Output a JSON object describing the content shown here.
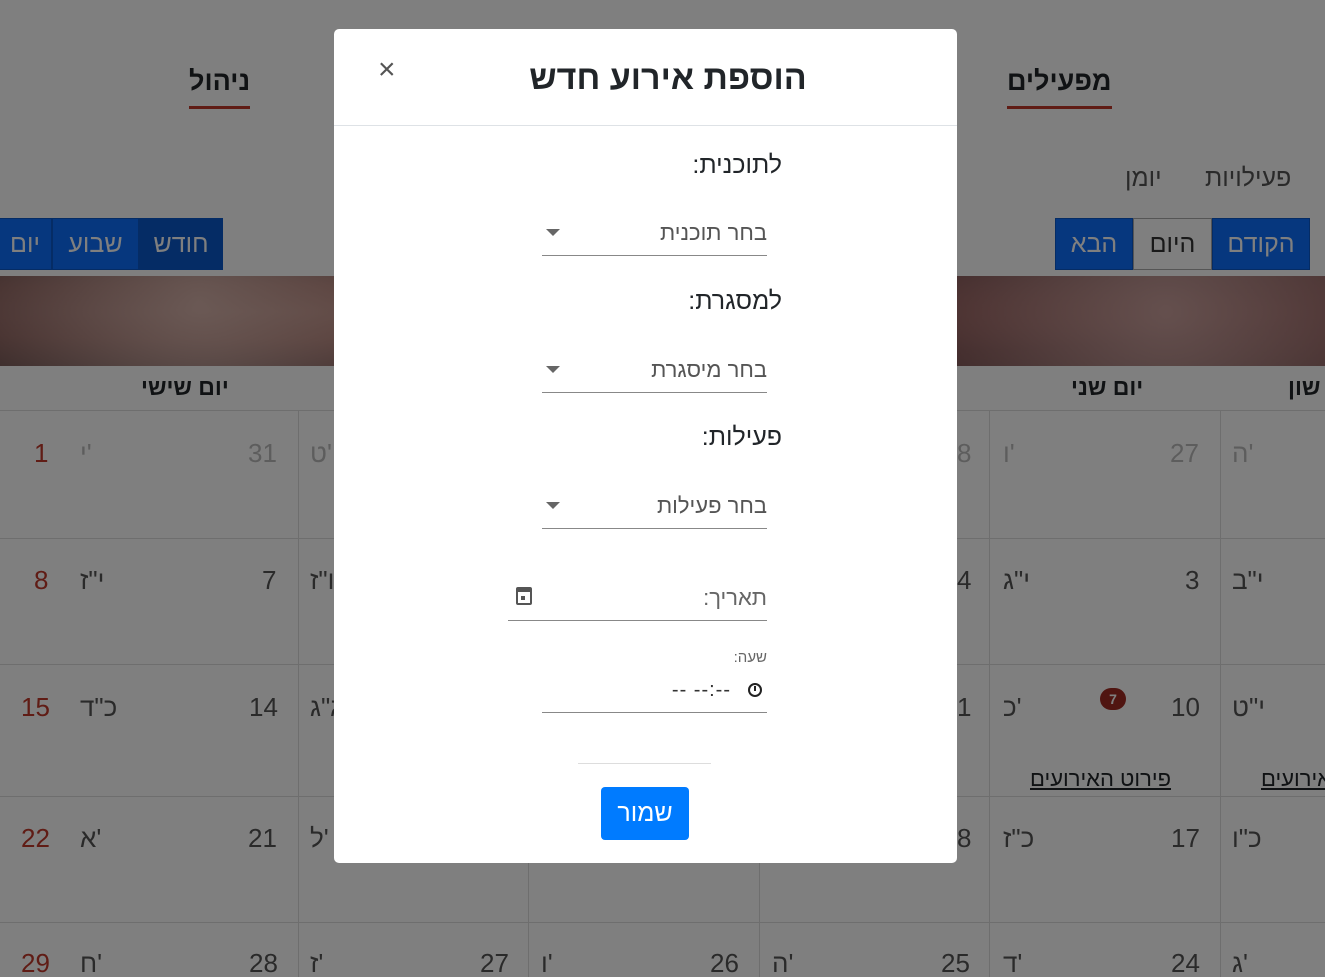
{
  "background": {
    "nav": {
      "manage": "ניהול",
      "operators": "מפעילים"
    },
    "sub_tabs": {
      "diary": "יומן",
      "activities": "פעילויות"
    },
    "view_buttons": {
      "day": "יום",
      "week": "שבוע",
      "month": "חודש"
    },
    "nav_buttons": {
      "next": "הבא",
      "today": "היום",
      "prev": "הקודם"
    },
    "day_headers": {
      "friday": "יום שישי",
      "monday": "יום שני",
      "sunday_partial": "שון"
    },
    "rows": [
      {
        "c_fri_heb": "י'",
        "c_fri_num": "1",
        "c_thu_num": "31",
        "c_thu_heb": "ט'",
        "c_mon_heb": "ו'",
        "c_mon_num": "27",
        "c_mon_prev": "8",
        "c_sun_heb": "ה'"
      },
      {
        "c_fri_heb": "י\"ז",
        "c_fri_num": "8",
        "c_thu_num": "7",
        "c_thu_heb": "ו\"ז",
        "c_mon_heb": "י\"ג",
        "c_mon_num": "3",
        "c_mon_prev": "4",
        "c_sun_heb": "י\"ב"
      },
      {
        "c_fri_heb": "כ\"ד",
        "c_fri_num": "15",
        "c_thu_num": "14",
        "c_thu_heb": "ג\"ג",
        "c_mon_heb": "כ'",
        "c_mon_num": "10",
        "c_mon_prev": "1",
        "c_sun_heb": "י\"ט"
      },
      {
        "c_fri_heb": "א'",
        "c_fri_num": "22",
        "c_thu_num": "21",
        "c_thu_heb": "ל'",
        "c_mon_heb": "כ\"ז",
        "c_mon_num": "17",
        "c_mon_prev": "8",
        "c_sun_heb": "כ\"ו"
      },
      {
        "c_fri_heb": "ח'",
        "c_fri_num": "29",
        "c_thu_num": "28",
        "c_thu_heb": "ז'",
        "c_wed_num": "27",
        "c_wed_heb": "ו'",
        "c_tue_num": "26",
        "c_tue_heb": "ה'",
        "c_mon_prev": "25",
        "c_mon_heb": "ד'",
        "c_mon_num": "24",
        "c_sun_heb": "ג'"
      }
    ],
    "badge_count": "7",
    "events_detail_link": "פירוט האירועים",
    "events_link_partial": "אירועים"
  },
  "modal": {
    "title": "הוספת אירוע חדש",
    "close_symbol": "×",
    "program": {
      "label": "לתוכנית:",
      "value": "בחר תוכנית"
    },
    "framework": {
      "label": "למסגרת:",
      "value": "בחר מיסגרת"
    },
    "activities": {
      "label": "פעילות:",
      "value": "בחר פעילות"
    },
    "date": {
      "placeholder": "תאריך:"
    },
    "time": {
      "label": "שעה:",
      "value": "-- --:--"
    },
    "save_label": "שמור"
  },
  "colors": {
    "primary": "#007bff",
    "nav_blue": "#0d6efd",
    "accent_red": "#c0392b",
    "badge": "#a02b22"
  }
}
